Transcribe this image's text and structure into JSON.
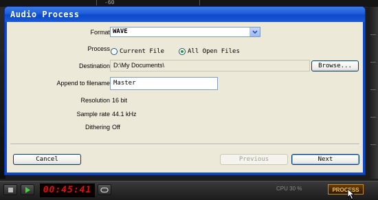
{
  "background": {
    "ruler_label": "-60"
  },
  "dialog": {
    "title": "Audio Process",
    "format": {
      "label": "Format",
      "value": "WAVE"
    },
    "process": {
      "label": "Process",
      "options": [
        {
          "label": "Current File",
          "selected": false
        },
        {
          "label": "All Open Files",
          "selected": true
        }
      ]
    },
    "destination": {
      "label": "Destination",
      "value": "D:\\My Documents\\",
      "browse_label": "Browse..."
    },
    "append": {
      "label": "Append to filename",
      "value": "Master"
    },
    "resolution": {
      "label": "Resolution",
      "value": "16 bit"
    },
    "sample_rate": {
      "label": "Sample rate",
      "value": "44.1 kHz"
    },
    "dithering": {
      "label": "Dithering",
      "value": "Off"
    },
    "buttons": {
      "cancel": "Cancel",
      "previous": "Previous",
      "next": "Next"
    }
  },
  "transport": {
    "time": "00:45:41",
    "cpu": "CPU 30 %",
    "process_label": "PROCESS"
  },
  "colors": {
    "titlebar": "#0a49c9",
    "dialog_bg": "#ece9d8",
    "clock": "#e01010",
    "process_text": "#f3c24a"
  }
}
